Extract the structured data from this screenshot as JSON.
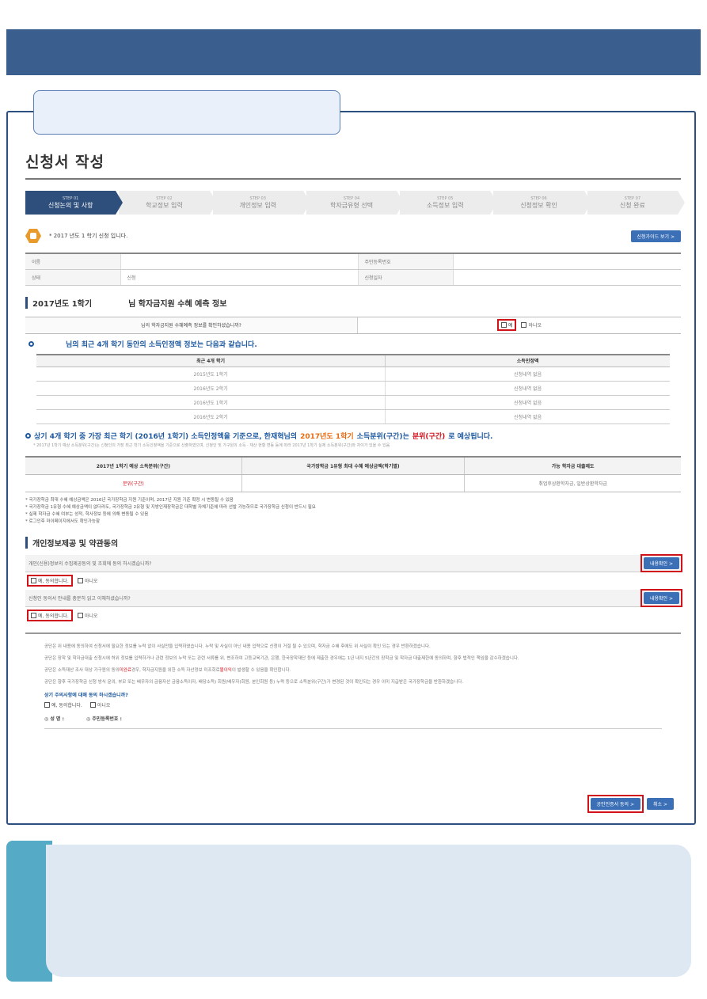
{
  "page": {
    "title": "신청서 작성"
  },
  "steps": [
    {
      "num": "STEP 01",
      "label": "신청논의 및 사항",
      "active": true
    },
    {
      "num": "STEP 02",
      "label": "학교정보 입력",
      "active": false
    },
    {
      "num": "STEP 03",
      "label": "개인정보 입력",
      "active": false
    },
    {
      "num": "STEP 04",
      "label": "학자금유형 선택",
      "active": false
    },
    {
      "num": "STEP 05",
      "label": "소득정보 입력",
      "active": false
    },
    {
      "num": "STEP 06",
      "label": "신청정보 확인",
      "active": false
    },
    {
      "num": "STEP 07",
      "label": "신청 완료",
      "active": false
    }
  ],
  "notice": {
    "text": "* 2017 년도 1 학기 신청 입니다.",
    "button": "신청가이드 보기 >"
  },
  "info_table": {
    "name_label": "이름",
    "name_value": "",
    "reg_label": "주민등록번호",
    "reg_value": "",
    "status_label": "상태",
    "status_value": "신청",
    "date_label": "신청일자",
    "date_value": ""
  },
  "section1": {
    "term": "2017년도 1학기",
    "title": "님 학자금지원 수혜 예측 정보",
    "question": "님의 학자금지원 수혜예측 정보를 확인하셨습니까?",
    "yes": "예",
    "no": "아니오"
  },
  "income_history": {
    "title": "님의 최근 4개 학기 동안의 소득인정액 정보는 다음과 같습니다.",
    "col1": "최근 4개 학기",
    "col2": "소득인정액",
    "rows": [
      {
        "term": "2015년도 1학기",
        "value": "신청내역 없음"
      },
      {
        "term": "2016년도 2학기",
        "value": "신청내역 없음"
      },
      {
        "term": "2016년도 1학기",
        "value": "신청내역 없음"
      },
      {
        "term": "2016년도 2학기",
        "value": "신청내역 없음"
      }
    ]
  },
  "prediction": {
    "part1": "상기 4개 학기 중 가장 최근 학기 (2016년 1학기) 소득인정액을 기준으로, 한재혁님의",
    "part2": "2017년도 1학기",
    "part3": "소득분위(구간)는",
    "part4": "분위(구간)",
    "part5": "로 예상됩니다.",
    "note": "* 2017년 1학기 예상 소득분위(구간)는 신청인의 가장 최근 학기 소득인정액을 기준으로 산출하였으며, 신청인 및 가구원의 소득 · 재산 현황 변동 등에 따라 2017년 1학기 실제 소득분위(구간)와 차이가 있을 수 있음",
    "col1": "2017년 1학기 예상 소득분위(구간)",
    "col2": "국가장학금 1유형 최대 수혜 예상금액(학기별)",
    "col3": "가능 학자금 대출제도",
    "val1": "분위(구간)",
    "val2": "",
    "val3": "취업후상환학자금, 일반상환학자금"
  },
  "notes": [
    "* 국가장학금 최대 수혜 예상금액은 2016년 국가장학금 지원 기준이며, 2017년 지원 기준 확정 시 변동될 수 있음",
    "* 국가장학금 1유형 수혜 예상금액이 없더라도, 국가장학금 2유형 및 지방인재장학금은 대학별 자체기준에 따라 선발 가능하므로 국가장학금 신청이 반드시 필요",
    "* 실제 학자금 수혜 여부는 성적, 학사정보 등에 의해 변동될 수 있음",
    "* 로그인후 마이페이지에서도 확인가능함"
  ],
  "section2": {
    "title": "개인정보제공 및 약관동의",
    "q1": "개인(신용)정보의 수집제공동의 및 조회에 동의 하시겠습니까?",
    "q2": "신청인 동의서 안내를 충분히 읽고 이해하셨습니까?",
    "detail_btn": "내용확인 >",
    "agree": "예, 동의합니다.",
    "disagree": "아니오"
  },
  "terms": {
    "p1": "공단은 위 내용에 동의하여 신청서에 필요한 정보를 누락 없이 사실만을 입력하였습니다. 누락 및 사실이 아닌 내용 입력으로 신청이 거절 될 수 있으며, 학자금 수혜 후에도 위 사실이 확인 되는 경우 반환하겠습니다.",
    "p2": "공단은 장학 및 학자금대출 신청시에 허위 정보를 입력하거나 관련 정보의 누락 또는 관련 서류를 위, 변조하여 고등교육기관, 은행, 한국장학재단 등에 제출한 경우에는 1년 내지 5년간의 장학금 및 학자금 대출제한에 동의하며, 향후 법적인 책임을 감수하겠습니다.",
    "p3a": "공단은 소득재산 조사 대상 가구원의 동의",
    "p3red": "미완료",
    "p3b": "경우, 학자금지원을 위한 소득 자산정보 미조회로",
    "p3red2": "불이익",
    "p3c": "이 발생할 수 있음을 확인합니다.",
    "p4": "공단은 향후 국가장학금 신청 방식 문의, 부모 또는 배우자의 금융자산 금융소득이자, 배당소득) 회원(배우자)회원, 본인회원 등) 누락 등으로 소득분위(구간)가 변경된 것이 확인되는 경우 이미 지급받은 국가장학금을 반환하겠습니다.",
    "question": "상기 주의사항에 대해 동의 하시겠습니까?",
    "agree": "예, 동의합니다.",
    "disagree": "아니오",
    "name_label": "◎ 성 명 :",
    "reg_label": "◎ 주민등록번호 :"
  },
  "actions": {
    "submit": "공인인증서 동의 >",
    "cancel": "취소 >"
  },
  "colors": {
    "brand": "#3a5f8f",
    "highlight": "#d0121b",
    "accent": "#1f5aa0"
  }
}
